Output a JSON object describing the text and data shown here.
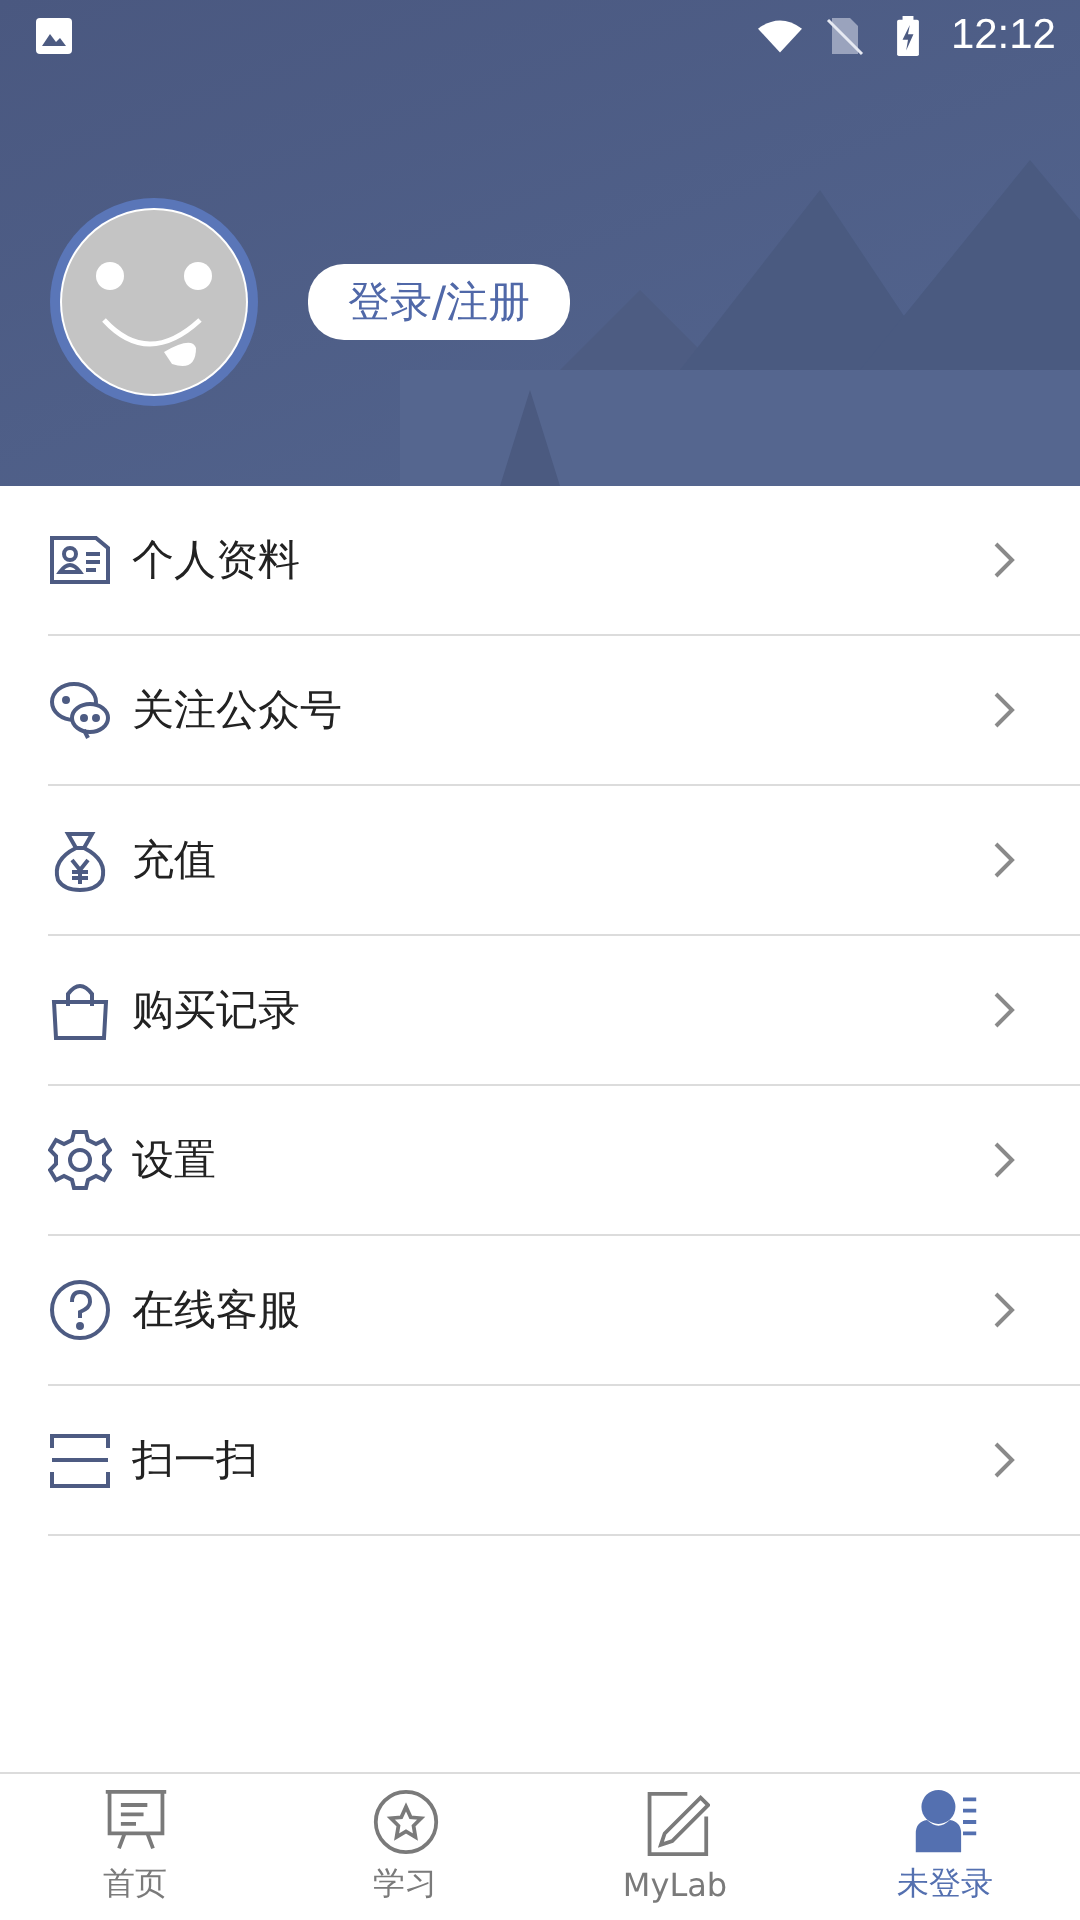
{
  "status_bar": {
    "time": "12:12"
  },
  "profile": {
    "login_label": "登录/注册"
  },
  "menu": [
    {
      "kind": "profile",
      "label": "个人资料"
    },
    {
      "kind": "chat",
      "label": "关注公众号"
    },
    {
      "kind": "money",
      "label": "充值"
    },
    {
      "kind": "bag",
      "label": "购买记录"
    },
    {
      "kind": "gear",
      "label": "设置"
    },
    {
      "kind": "help",
      "label": "在线客服"
    },
    {
      "kind": "scan",
      "label": "扫一扫"
    }
  ],
  "tabs": [
    {
      "kind": "board",
      "label": "首页",
      "selected": false
    },
    {
      "kind": "star",
      "label": "学习",
      "selected": false
    },
    {
      "kind": "pencil",
      "label": "MyLab",
      "selected": false
    },
    {
      "kind": "user",
      "label": "未登录",
      "selected": true
    }
  ]
}
